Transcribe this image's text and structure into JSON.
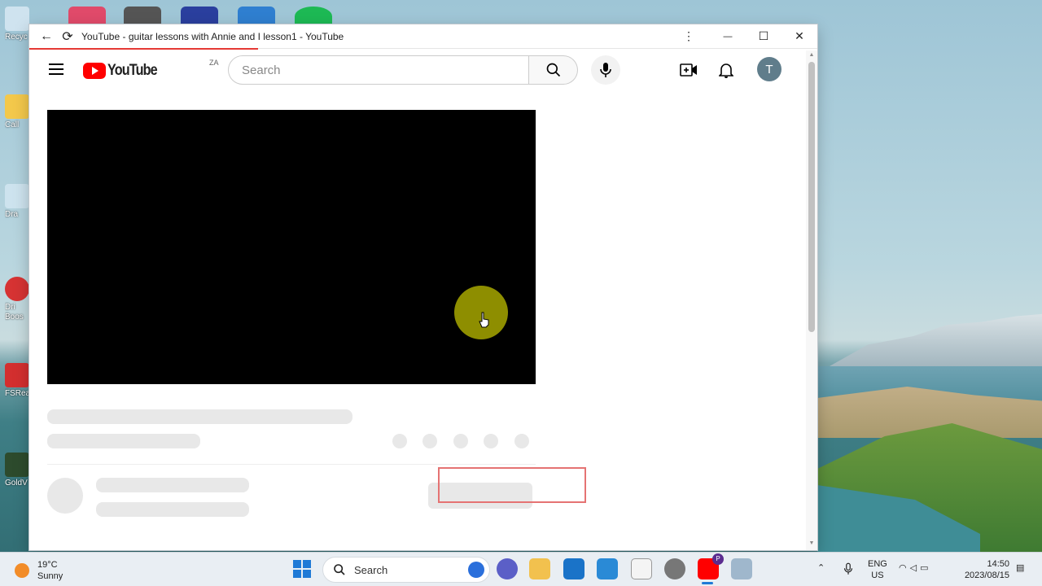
{
  "browser": {
    "title": "YouTube - guitar lessons with Annie and I lesson1 - YouTube",
    "back_icon": "←",
    "reload_icon": "⟳",
    "menu_icon": "⋮",
    "minimize_icon": "—",
    "maximize_icon": "☐",
    "close_icon": "✕",
    "load_progress": 0.29
  },
  "youtube": {
    "logo_text": "YouTube",
    "country_code": "ZA",
    "search_placeholder": "Search",
    "avatar_initial": "T"
  },
  "desktop": {
    "icons": [
      "Recyc",
      "Call",
      "Dra",
      "Dri Boos",
      "FSRead",
      "GoldV"
    ]
  },
  "taskbar": {
    "weather_temp": "19°C",
    "weather_desc": "Sunny",
    "search_label": "Search",
    "language": "ENG",
    "region": "US",
    "time": "14:50",
    "date": "2023/08/15",
    "notification_badge": "P"
  },
  "colors": {
    "youtube_red": "#ff0000",
    "progress_red": "#e53935",
    "highlight_box": "#e57373",
    "cursor_highlight": "#bebe00"
  }
}
